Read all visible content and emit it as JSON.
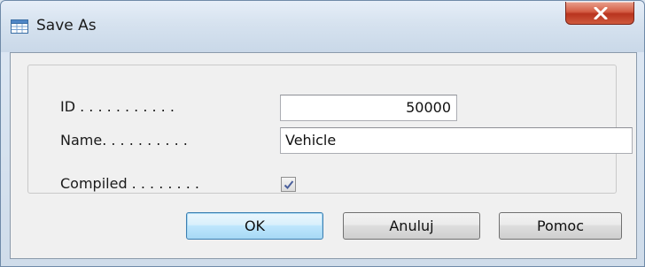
{
  "window": {
    "title": "Save As",
    "close_glyph": "✕"
  },
  "form": {
    "id": {
      "label": "ID . . . . . . . . . . .",
      "value": "50000"
    },
    "name": {
      "label": "Name. . . . . . . . . .",
      "value": "Vehicle"
    },
    "compiled": {
      "label": "Compiled . . . . . . . .",
      "checked": true
    }
  },
  "buttons": {
    "ok": "OK",
    "cancel": "Anuluj",
    "help": "Pomoc"
  },
  "colors": {
    "close_button": "#c8432a",
    "default_button_border": "#3c7fb1",
    "checkmark": "#4a5f9c"
  },
  "icons": {
    "title": "table-icon",
    "close": "close-icon",
    "check": "checkmark-icon"
  }
}
